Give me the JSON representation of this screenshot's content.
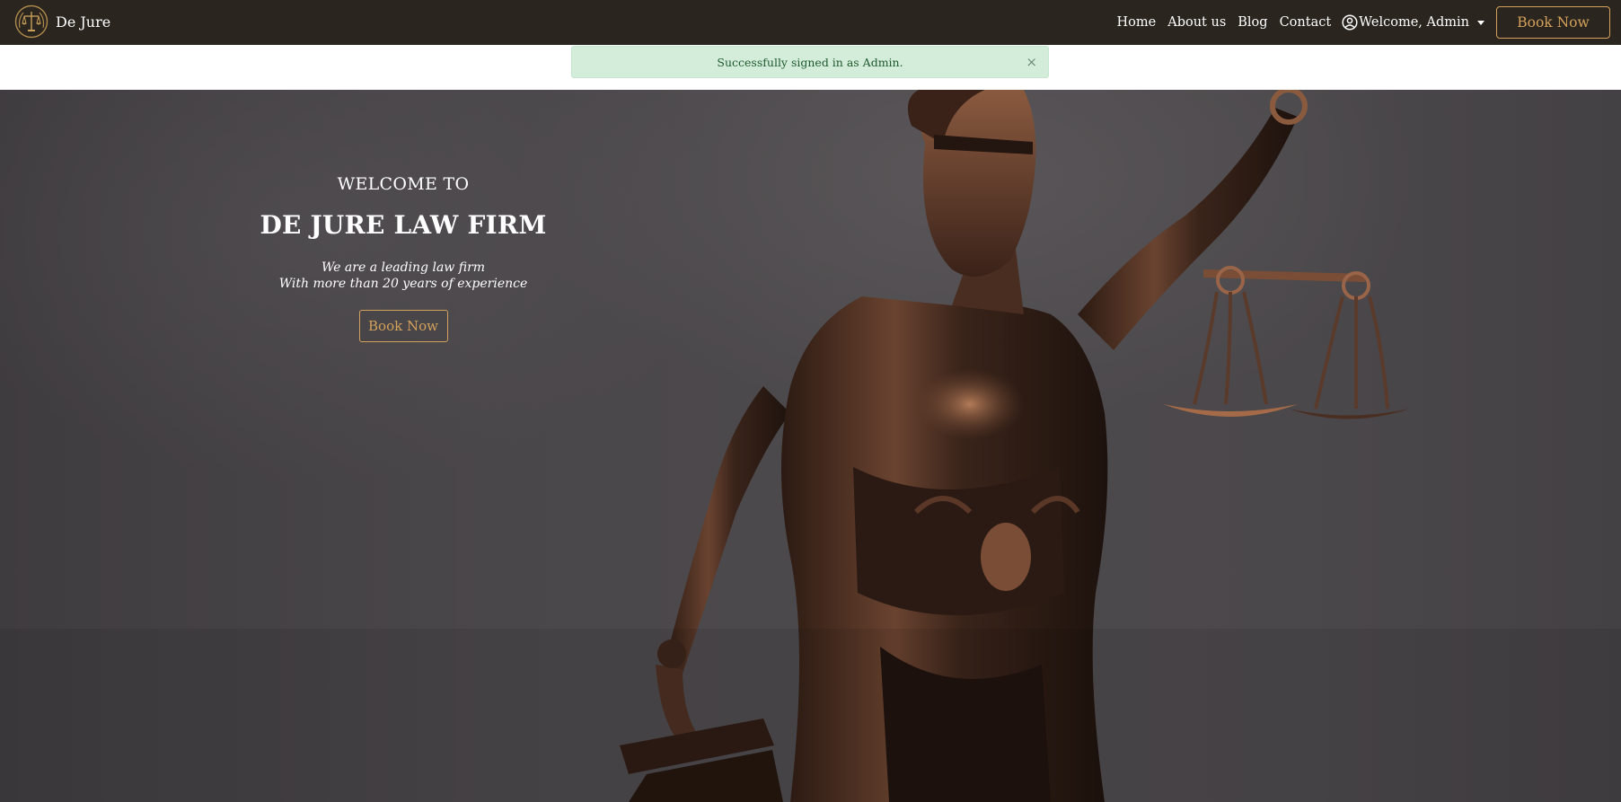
{
  "navbar": {
    "brand": "De Jure",
    "links": [
      "Home",
      "About us",
      "Blog",
      "Contact"
    ],
    "user_label": "Welcome, Admin",
    "book_label": "Book Now"
  },
  "alert": {
    "message": "Successfully signed in as Admin.",
    "close": "×"
  },
  "hero": {
    "welcome": "WELCOME TO",
    "title": "DE JURE LAW FIRM",
    "subtitle_line1": "We are a leading law firm",
    "subtitle_line2": "With more than 20 years of experience",
    "book_label": "Book Now"
  },
  "colors": {
    "navbar_bg": "#2a251f",
    "accent": "#d4a15b",
    "alert_bg": "#d4eddb",
    "alert_text": "#1e5a2d"
  },
  "icons": {
    "brand": "scales-of-justice-icon",
    "user": "user-circle-icon",
    "dropdown": "caret-down-icon",
    "close": "close-icon"
  }
}
